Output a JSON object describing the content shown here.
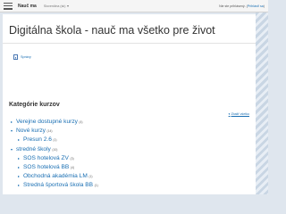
{
  "navbar": {
    "brand": "Nauč ma",
    "language": "Slovenčina (sk)",
    "login_status": "Nie ste prihlásený. (",
    "login_link": "Prihlásiť sa",
    "login_close": ")"
  },
  "header": {
    "site_title": "Digitálna škola - nauč ma všetko pre život"
  },
  "news": {
    "link_label": "Správy"
  },
  "categories": {
    "heading": "Kategórie kurzov",
    "collapse_all": "Zbaliť všetko",
    "items": [
      {
        "label": "Verejne dostupné kurzy",
        "count": "(4)",
        "expanded": false,
        "level": 0
      },
      {
        "label": "Nové kurzy",
        "count": "(14)",
        "expanded": true,
        "level": 0
      },
      {
        "label": "Presun 2.6",
        "count": "(1)",
        "expanded": false,
        "level": 1
      },
      {
        "label": "stredné školy",
        "count": "(10)",
        "expanded": true,
        "level": 0
      },
      {
        "label": "SOS hotelová ZV",
        "count": "(3)",
        "expanded": false,
        "level": 1
      },
      {
        "label": "SOS hotelová BB",
        "count": "(4)",
        "expanded": false,
        "level": 1
      },
      {
        "label": "Obchodná akadémia LM",
        "count": "(1)",
        "expanded": false,
        "level": 1
      },
      {
        "label": "Stredná športová škola BB",
        "count": "(1)",
        "expanded": false,
        "level": 1
      }
    ]
  },
  "colors": {
    "link": "#1a6fb3",
    "navbar_bg": "#f5f5f5",
    "page_bg": "#dfe6ee"
  }
}
